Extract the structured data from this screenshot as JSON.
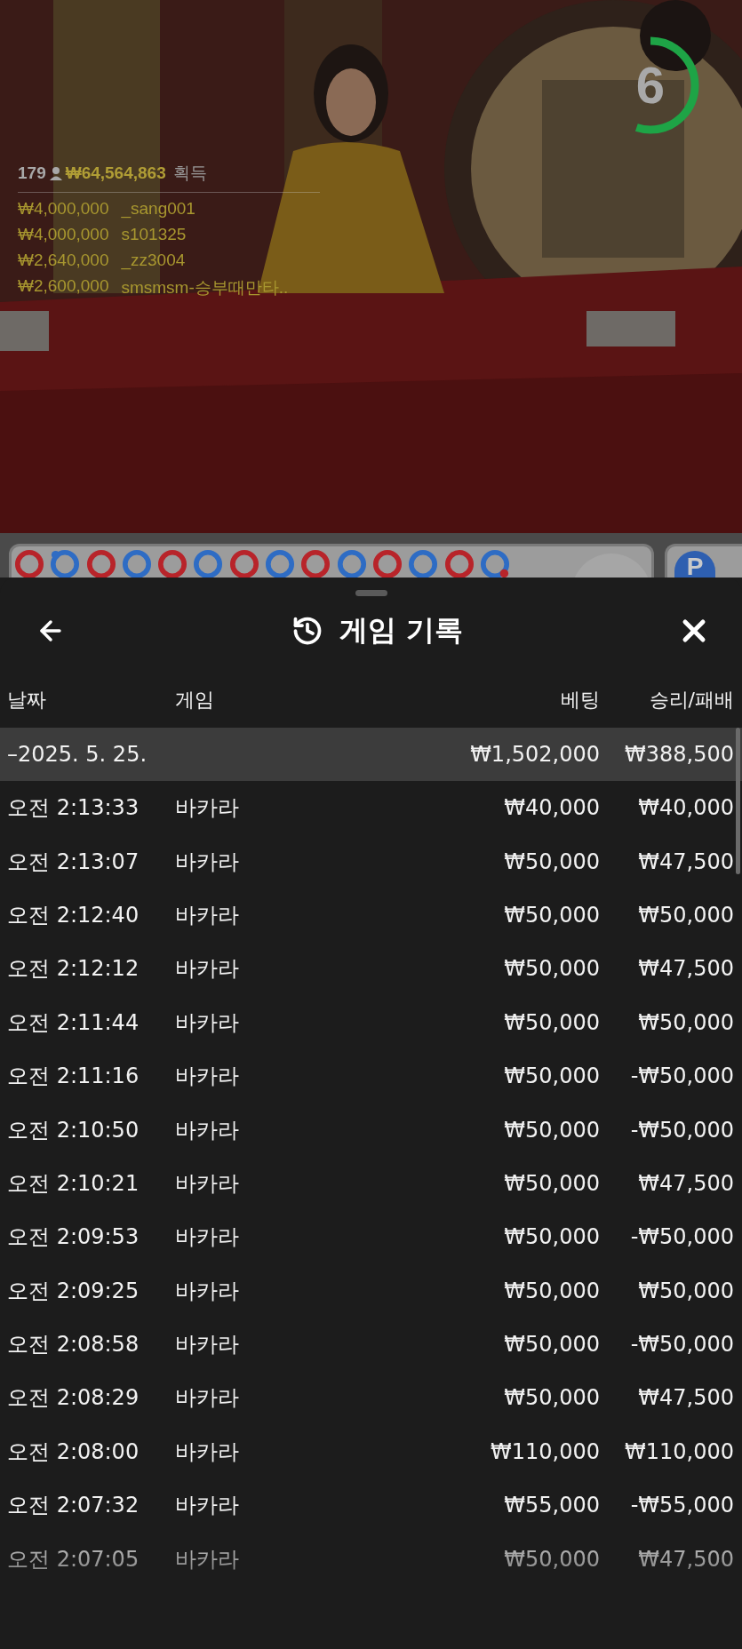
{
  "video": {
    "kind": "picture",
    "timer": {
      "count": "6",
      "level": 0.55
    },
    "leaderboard": {
      "players": "179",
      "total": "₩64,564,863",
      "label": "획득",
      "winners": [
        {
          "amount": "₩4,000,000",
          "name": "_sang001"
        },
        {
          "amount": "₩4,000,000",
          "name": "s101325"
        },
        {
          "amount": "₩2,640,000",
          "name": "_zz3004"
        },
        {
          "amount": "₩2,600,000",
          "name": "smsmsm-승부때만타.."
        }
      ]
    }
  },
  "bead_road": {
    "beads": [
      {
        "color": "#b8242a"
      },
      {
        "color": "#2e6cc4",
        "kind": "topdot",
        "dot": {
          "color": "#2e6cc4"
        }
      },
      {
        "color": "#b8242a"
      },
      {
        "color": "#2e6cc4"
      },
      {
        "color": "#b8242a"
      },
      {
        "color": "#2e6cc4"
      },
      {
        "color": "#b8242a"
      },
      {
        "color": "#2e6cc4"
      },
      {
        "color": "#b8242a"
      },
      {
        "color": "#2e6cc4"
      },
      {
        "color": "#b8242a"
      },
      {
        "color": "#2e6cc4"
      },
      {
        "color": "#b8242a"
      },
      {
        "color": "#2e6cc4",
        "kind": "bottomdot",
        "dot": {
          "color": "#b8242a"
        }
      }
    ],
    "side_button": "P"
  },
  "sheet": {
    "title": "게임 기록",
    "columns": [
      "날짜",
      "게임",
      "베팅",
      "승리/패배"
    ],
    "groups": [
      {
        "date": "–2025. 5. 25.",
        "bet": "₩1,502,000",
        "result": "₩388,500",
        "rows": [
          {
            "time": "오전 2:13:33",
            "game": "바카라",
            "bet": "₩40,000",
            "result": "₩40,000"
          },
          {
            "time": "오전 2:13:07",
            "game": "바카라",
            "bet": "₩50,000",
            "result": "₩47,500"
          },
          {
            "time": "오전 2:12:40",
            "game": "바카라",
            "bet": "₩50,000",
            "result": "₩50,000"
          },
          {
            "time": "오전 2:12:12",
            "game": "바카라",
            "bet": "₩50,000",
            "result": "₩47,500"
          },
          {
            "time": "오전 2:11:44",
            "game": "바카라",
            "bet": "₩50,000",
            "result": "₩50,000"
          },
          {
            "time": "오전 2:11:16",
            "game": "바카라",
            "bet": "₩50,000",
            "result": "-₩50,000"
          },
          {
            "time": "오전 2:10:50",
            "game": "바카라",
            "bet": "₩50,000",
            "result": "-₩50,000"
          },
          {
            "time": "오전 2:10:21",
            "game": "바카라",
            "bet": "₩50,000",
            "result": "₩47,500"
          },
          {
            "time": "오전 2:09:53",
            "game": "바카라",
            "bet": "₩50,000",
            "result": "-₩50,000"
          },
          {
            "time": "오전 2:09:25",
            "game": "바카라",
            "bet": "₩50,000",
            "result": "₩50,000"
          },
          {
            "time": "오전 2:08:58",
            "game": "바카라",
            "bet": "₩50,000",
            "result": "-₩50,000"
          },
          {
            "time": "오전 2:08:29",
            "game": "바카라",
            "bet": "₩50,000",
            "result": "₩47,500"
          },
          {
            "time": "오전 2:08:00",
            "game": "바카라",
            "bet": "₩110,000",
            "result": "₩110,000"
          },
          {
            "time": "오전 2:07:32",
            "game": "바카라",
            "bet": "₩55,000",
            "result": "-₩55,000"
          },
          {
            "time": "오전 2:07:05",
            "game": "바카라",
            "bet": "₩50,000",
            "result": "₩47,500"
          }
        ]
      }
    ]
  }
}
